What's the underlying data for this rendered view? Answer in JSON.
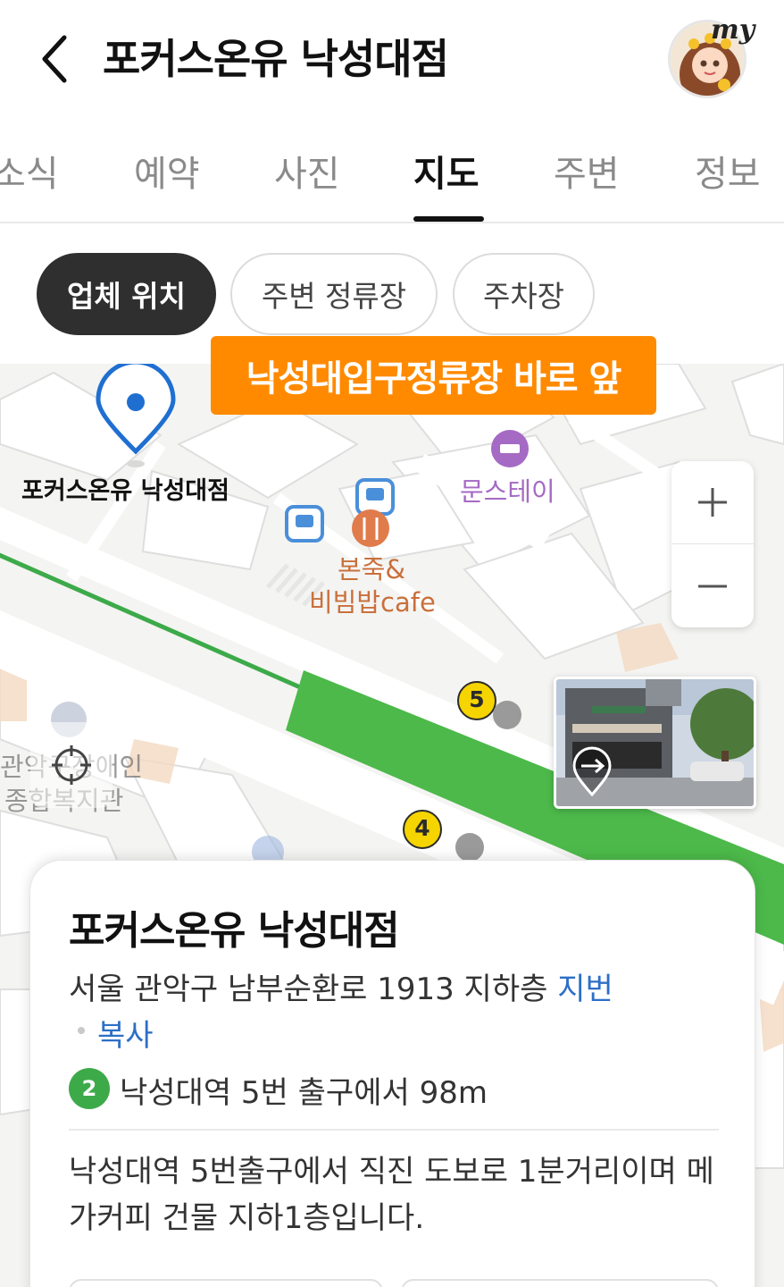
{
  "header": {
    "title": "포커스온유 낙성대점",
    "avatar_tag": "my"
  },
  "tabs": [
    {
      "label": "소식"
    },
    {
      "label": "예약"
    },
    {
      "label": "사진"
    },
    {
      "label": "지도",
      "active": true
    },
    {
      "label": "주변"
    },
    {
      "label": "정보"
    }
  ],
  "chips": [
    {
      "label": "업체 위치",
      "active": true
    },
    {
      "label": "주변 정류장"
    },
    {
      "label": "주차장"
    }
  ],
  "map": {
    "banner": "낙성대입구정류장 바로 앞",
    "pin_label": "포커스온유 낙성대점",
    "poi_stay": "문스테이",
    "poi_restaurant_line1": "본죽&",
    "poi_restaurant_line2": "비빔밥cafe",
    "exit_5": "5",
    "exit_4": "4",
    "bg_label_line1": "관악구장애인",
    "bg_label_line2": "종합복지관",
    "colors": {
      "banner": "#ff8a00",
      "subway_line": "#3daa4a",
      "pin": "#1f6fd1",
      "restaurant": "#e07b4b",
      "stay": "#a56ac4",
      "bus": "#4a8fd9"
    }
  },
  "card": {
    "title": "포커스온유 낙성대점",
    "address": "서울 관악구 남부순환로 1913 지하층",
    "lot_link": "지번",
    "copy_link": "복사",
    "subway_line": "2",
    "subway_text": "낙성대역 5번 출구에서 98m",
    "description": "낙성대역 5번출구에서 직진 도보로 1분거리이며 메가커피 건물 지하1층입니다."
  }
}
